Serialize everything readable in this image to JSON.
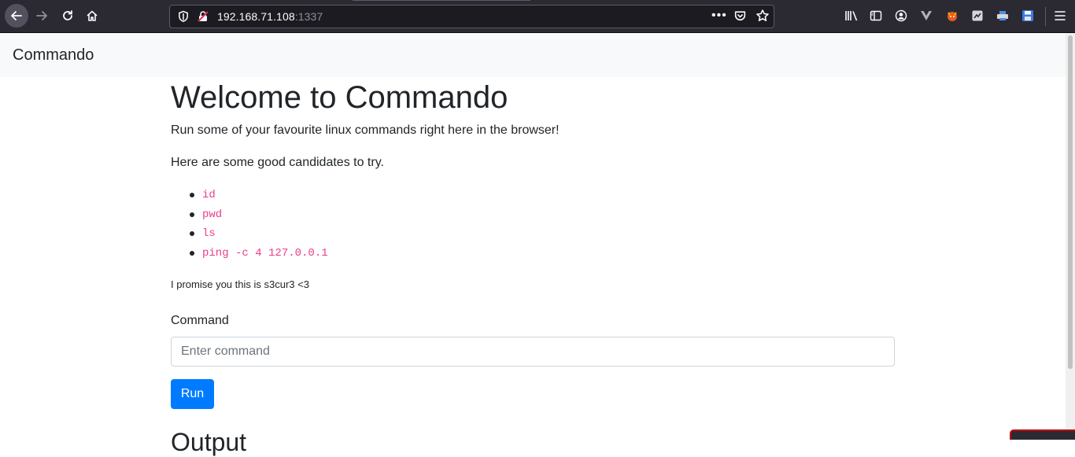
{
  "browser": {
    "url_host": "192.168.71.108",
    "url_port": ":1337",
    "more_label": "•••"
  },
  "navbar": {
    "brand": "Commando"
  },
  "main": {
    "title": "Welcome to Commando",
    "lead1": "Run some of your favourite linux commands right here in the browser!",
    "lead2": "Here are some good candidates to try.",
    "commands": [
      "id",
      "pwd",
      "ls",
      "ping -c 4 127.0.0.1"
    ],
    "note": "I promise you this is s3cur3 <3",
    "command_label": "Command",
    "command_placeholder": "Enter command",
    "command_value": "",
    "run_label": "Run",
    "output_heading": "Output"
  },
  "colors": {
    "primary": "#007bff",
    "code": "#e83e8c",
    "navbar_bg": "#f8f9fa",
    "chrome_bg": "#2b2a33"
  },
  "icons": {
    "back": "arrow-left-icon",
    "forward": "arrow-right-icon",
    "reload": "reload-icon",
    "home": "home-icon",
    "shield": "tracking-shield-icon",
    "insecure": "insecure-lock-icon",
    "pocket": "pocket-icon",
    "bookmark": "star-icon",
    "library": "library-icon",
    "sidebar": "sidebar-icon",
    "account": "account-icon",
    "menu": "hamburger-menu-icon"
  }
}
